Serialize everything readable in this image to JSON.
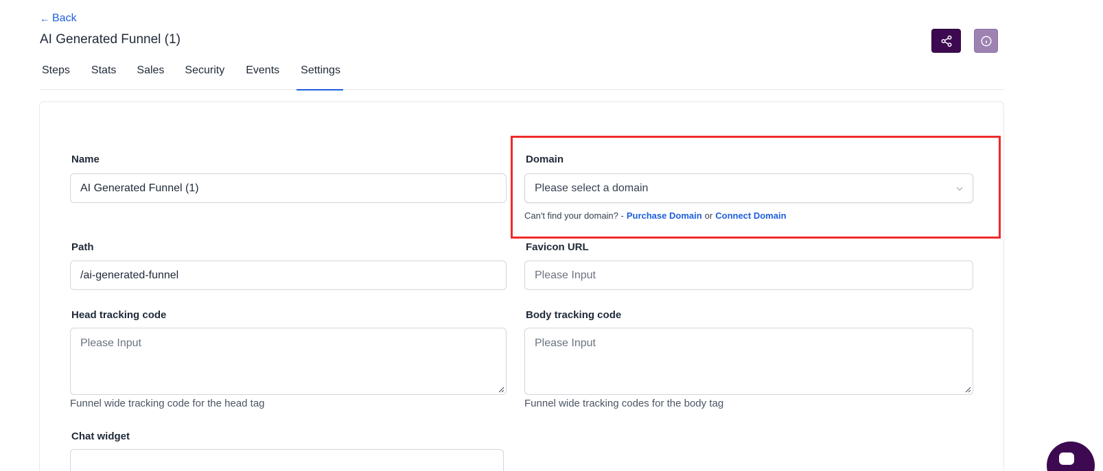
{
  "header": {
    "back_label": "Back",
    "title": "AI Generated Funnel (1)",
    "share_icon": "share-icon",
    "info_icon": "info-icon",
    "share_btn_color": "#3d0a51",
    "info_btn_color": "#9d82b2"
  },
  "tabs": [
    {
      "label": "Steps",
      "active": false
    },
    {
      "label": "Stats",
      "active": false
    },
    {
      "label": "Sales",
      "active": false
    },
    {
      "label": "Security",
      "active": false
    },
    {
      "label": "Events",
      "active": false
    },
    {
      "label": "Settings",
      "active": true
    }
  ],
  "form": {
    "name": {
      "label": "Name",
      "value": "AI Generated Funnel (1)"
    },
    "domain": {
      "label": "Domain",
      "placeholder": "Please select a domain",
      "help_prefix": "Can't find your domain? -",
      "purchase_link": "Purchase Domain",
      "or": "or",
      "connect_link": "Connect Domain"
    },
    "path": {
      "label": "Path",
      "value": "/ai-generated-funnel"
    },
    "favicon": {
      "label": "Favicon URL",
      "placeholder": "Please Input"
    },
    "head_tracking": {
      "label": "Head tracking code",
      "placeholder": "Please Input",
      "help": "Funnel wide tracking code for the head tag"
    },
    "body_tracking": {
      "label": "Body tracking code",
      "placeholder": "Please Input",
      "help": "Funnel wide tracking codes for the body tag"
    },
    "chat_widget": {
      "label": "Chat widget"
    }
  },
  "colors": {
    "accent": "#1e5ede",
    "highlight": "#ef2a2a"
  }
}
